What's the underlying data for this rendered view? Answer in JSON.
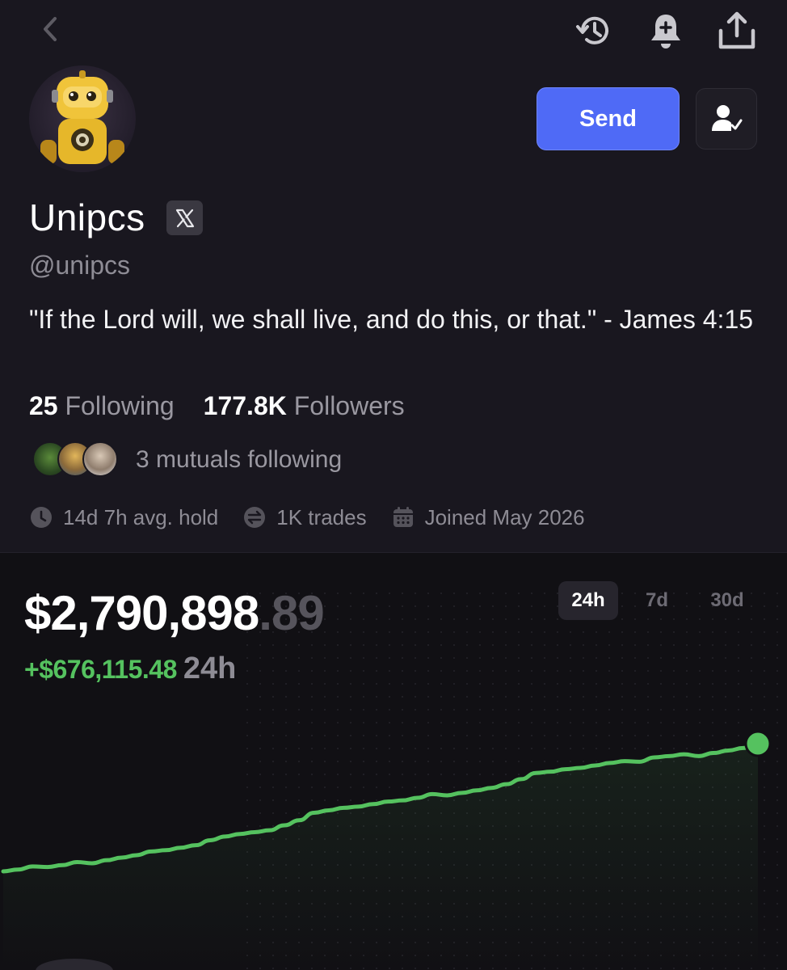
{
  "profile": {
    "name": "Unipcs",
    "handle": "@unipcs",
    "bio": "\"If the Lord will, we shall live, and do this, or that.\" - James 4:15",
    "following_count": "25",
    "following_label": "Following",
    "followers_count": "177.8K",
    "followers_label": "Followers",
    "mutuals_text": "3 mutuals following"
  },
  "actions": {
    "send_label": "Send"
  },
  "meta": {
    "avg_hold": "14d 7h avg. hold",
    "trades": "1K trades",
    "joined": "Joined May 2026"
  },
  "portfolio": {
    "balance_main": "$2,790,898",
    "balance_cents": ".89",
    "change_value": "+$676,115.48",
    "change_period": "24h",
    "periods": [
      "24h",
      "7d",
      "30d"
    ],
    "selected_period": "24h"
  },
  "icons": {
    "back": "chevron-left-icon",
    "history": "history-icon",
    "bell": "bell-plus-icon",
    "share": "share-icon",
    "follow": "user-check-icon",
    "x": "x-logo-icon",
    "clock": "clock-icon",
    "swap": "swap-icon",
    "calendar": "calendar-icon"
  },
  "colors": {
    "accent": "#4f6af6",
    "positive": "#55c25f",
    "background": "#19171f",
    "muted": "#9a98a1"
  },
  "chart_data": {
    "type": "line",
    "values": [
      1000,
      1003,
      1008,
      1007,
      1010,
      1015,
      1013,
      1018,
      1022,
      1026,
      1032,
      1034,
      1038,
      1042,
      1050,
      1056,
      1060,
      1063,
      1066,
      1074,
      1082,
      1094,
      1098,
      1102,
      1104,
      1108,
      1112,
      1114,
      1118,
      1124,
      1122,
      1126,
      1130,
      1134,
      1140,
      1148,
      1158,
      1160,
      1164,
      1166,
      1170,
      1174,
      1177,
      1176,
      1183,
      1185,
      1188,
      1185,
      1190,
      1194,
      1198,
      1205
    ],
    "line_color": "#55c25f"
  }
}
